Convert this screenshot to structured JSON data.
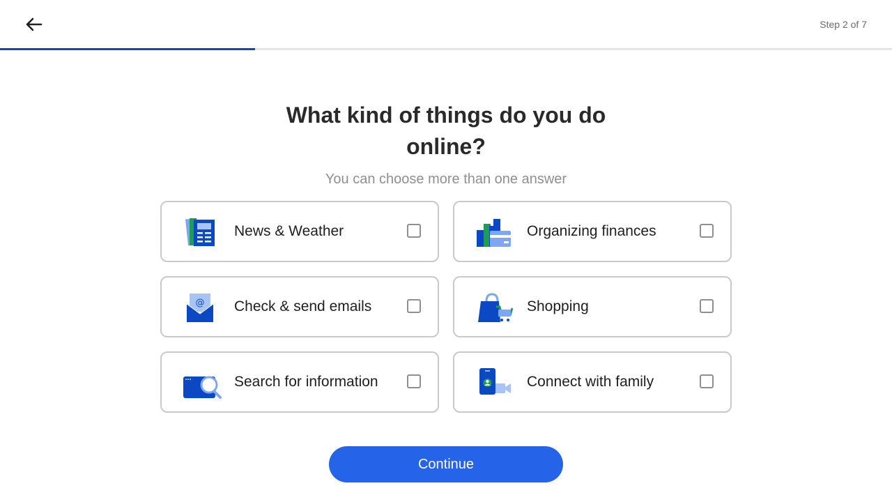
{
  "header": {
    "back_icon": "arrow-left-icon",
    "step_label": "Step 2 of 7",
    "progress": {
      "current": 2,
      "total": 7,
      "fraction": 0.2857,
      "color": "#0b49c4"
    }
  },
  "main": {
    "title": "What kind of things do you do online?",
    "subtitle": "You can choose more than one answer",
    "options": [
      {
        "label": "News & Weather",
        "icon": "newspaper-icon",
        "checked": false
      },
      {
        "label": "Organizing finances",
        "icon": "finances-icon",
        "checked": false
      },
      {
        "label": "Check & send emails",
        "icon": "email-envelope-icon",
        "checked": false
      },
      {
        "label": "Shopping",
        "icon": "shopping-bag-icon",
        "checked": false
      },
      {
        "label": "Search for information",
        "icon": "search-browser-icon",
        "checked": false
      },
      {
        "label": "Connect with family",
        "icon": "video-call-icon",
        "checked": false
      }
    ]
  },
  "footer": {
    "continue_label": "Continue",
    "button_color": "#2563e8"
  }
}
